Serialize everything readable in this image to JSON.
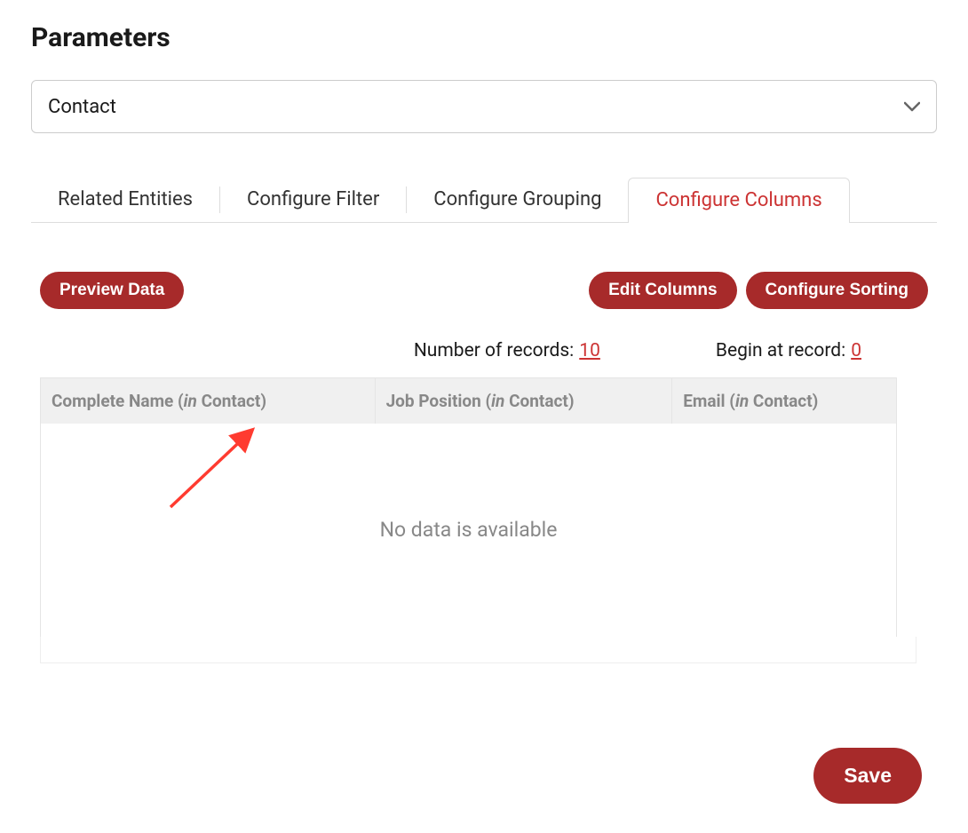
{
  "page": {
    "title": "Parameters"
  },
  "entity_select": {
    "value": "Contact"
  },
  "tabs": [
    {
      "label": "Related Entities",
      "active": false
    },
    {
      "label": "Configure Filter",
      "active": false
    },
    {
      "label": "Configure Grouping",
      "active": false
    },
    {
      "label": "Configure Columns",
      "active": true
    }
  ],
  "buttons": {
    "preview_data": "Preview Data",
    "edit_columns": "Edit Columns",
    "configure_sorting": "Configure Sorting",
    "save": "Save"
  },
  "records": {
    "number_label": "Number of records:",
    "number_value": "10",
    "begin_label": "Begin at record:",
    "begin_value": "0"
  },
  "columns": [
    {
      "field": "Complete Name",
      "in_word": "in",
      "entity": "Contact"
    },
    {
      "field": "Job Position",
      "in_word": "in",
      "entity": "Contact"
    },
    {
      "field": "Email",
      "in_word": "in",
      "entity": "Contact"
    }
  ],
  "table": {
    "empty_message": "No data is available"
  },
  "annotation": {
    "arrow_color": "#ff3b30"
  }
}
